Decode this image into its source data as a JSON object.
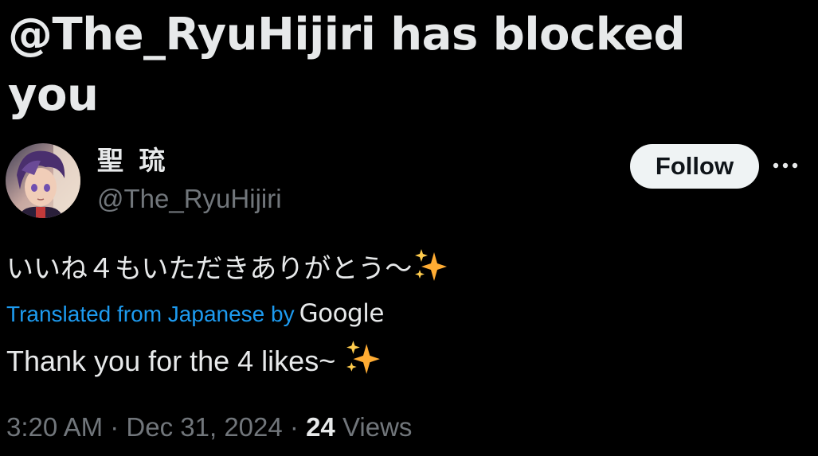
{
  "page": {
    "title": "@The_RyuHijiri has blocked you"
  },
  "author": {
    "display_name": "聖 琉",
    "handle": "@The_RyuHijiri",
    "avatar_icon": "avatar-image"
  },
  "actions": {
    "follow_label": "Follow",
    "more_icon": "more-dots-icon"
  },
  "tweet": {
    "original_text": "いいね４もいただきありがとう〜",
    "translated_label": "Translated from Japanese by",
    "translator_brand": "Google",
    "translated_text": "Thank you for the 4 likes~",
    "emoji": "sparkles-icon"
  },
  "meta": {
    "time": "3:20 AM",
    "separator": "·",
    "date": "Dec 31, 2024",
    "views_count": "24",
    "views_label": "Views"
  },
  "colors": {
    "background": "#000000",
    "primary_text": "#e7e9ea",
    "secondary_text": "#71767b",
    "link": "#1d9bf0",
    "follow_bg": "#eff3f4",
    "sparkle": "#ffac33"
  }
}
